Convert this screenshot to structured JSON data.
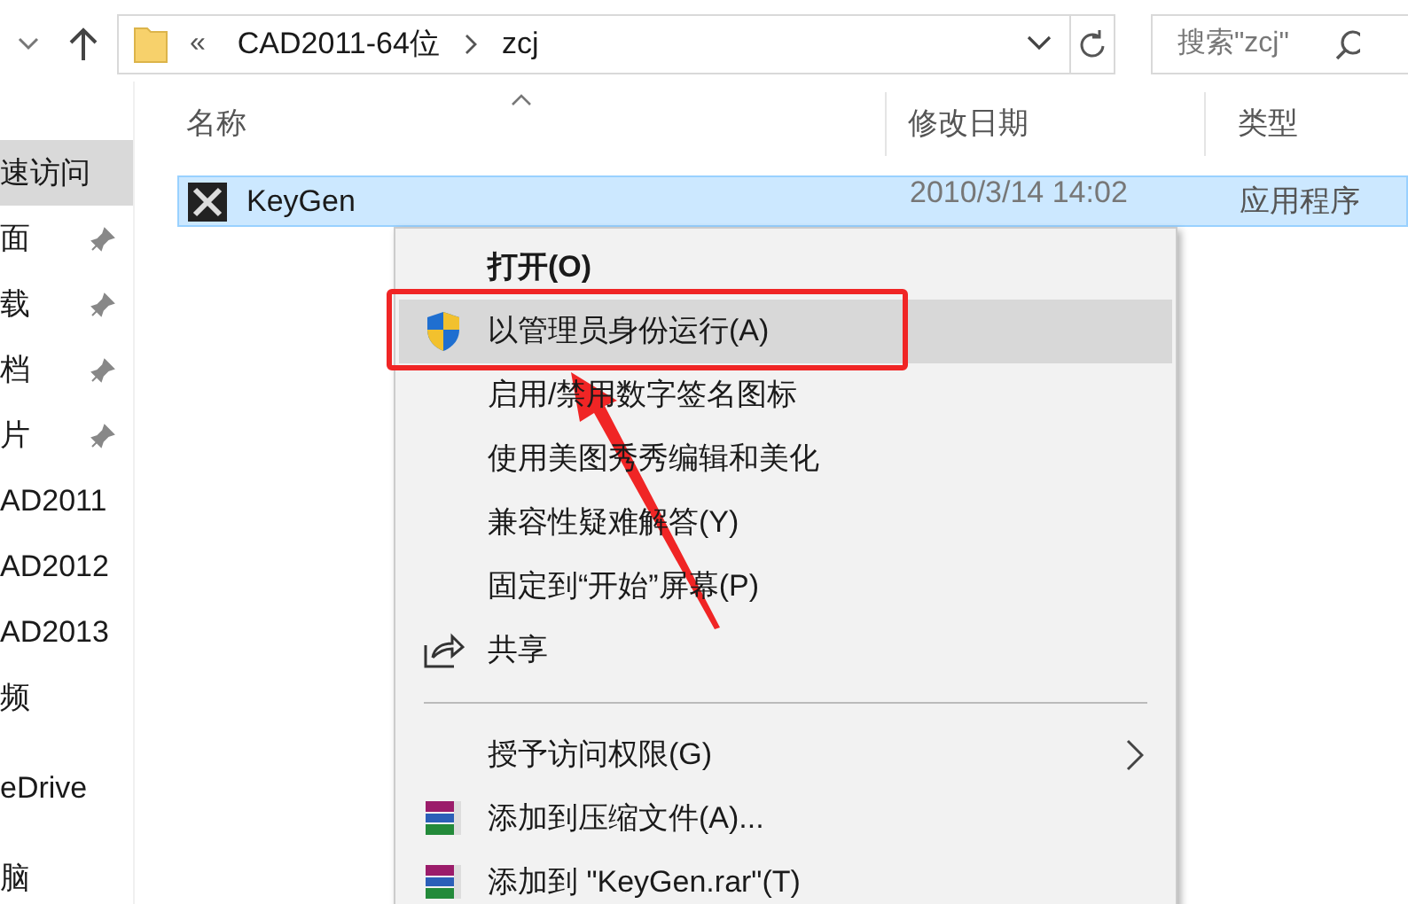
{
  "address_bar": {
    "overflow": "«",
    "path": [
      "CAD2011-64位",
      "zcj"
    ]
  },
  "search": {
    "placeholder": "搜索\"zcj\""
  },
  "sidebar": {
    "groups": [
      {
        "items": [
          {
            "label": "速访问",
            "selected": true,
            "pinned": false
          },
          {
            "label": "面",
            "selected": false,
            "pinned": true
          },
          {
            "label": "载",
            "selected": false,
            "pinned": true
          },
          {
            "label": "档",
            "selected": false,
            "pinned": true
          },
          {
            "label": "片",
            "selected": false,
            "pinned": true
          },
          {
            "label": "AD2011",
            "selected": false,
            "pinned": false
          },
          {
            "label": "AD2012",
            "selected": false,
            "pinned": false
          },
          {
            "label": "AD2013",
            "selected": false,
            "pinned": false
          },
          {
            "label": "频",
            "selected": false,
            "pinned": false
          }
        ]
      },
      {
        "items": [
          {
            "label": "eDrive",
            "selected": false,
            "pinned": false
          }
        ]
      },
      {
        "items": [
          {
            "label": "脑",
            "selected": false,
            "pinned": false
          }
        ]
      }
    ]
  },
  "columns": [
    "名称",
    "修改日期",
    "类型"
  ],
  "files": [
    {
      "name": "KeyGen",
      "date": "2010/3/14 14:02",
      "type": "应用程序",
      "selected": true
    }
  ],
  "context_menu": {
    "items": [
      {
        "label": "打开(O)",
        "kind": "plain",
        "default": true,
        "selected": false
      },
      {
        "label": "以管理员身份运行(A)",
        "kind": "shield",
        "default": false,
        "selected": true
      },
      {
        "label": "启用/禁用数字签名图标",
        "kind": "plain",
        "default": false,
        "selected": false
      },
      {
        "label": "使用美图秀秀编辑和美化",
        "kind": "plain",
        "default": false,
        "selected": false
      },
      {
        "label": "兼容性疑难解答(Y)",
        "kind": "plain",
        "default": false,
        "selected": false
      },
      {
        "label": "固定到“开始”屏幕(P)",
        "kind": "plain",
        "default": false,
        "selected": false
      },
      {
        "label": "共享",
        "kind": "share",
        "default": false,
        "selected": false
      },
      {
        "kind": "separator"
      },
      {
        "label": "授予访问权限(G)",
        "kind": "submenu",
        "default": false,
        "selected": false
      },
      {
        "label": "添加到压缩文件(A)...",
        "kind": "archive",
        "default": false,
        "selected": false
      },
      {
        "label": "添加到 \"KeyGen.rar\"(T)",
        "kind": "archive",
        "default": false,
        "selected": false
      }
    ]
  }
}
